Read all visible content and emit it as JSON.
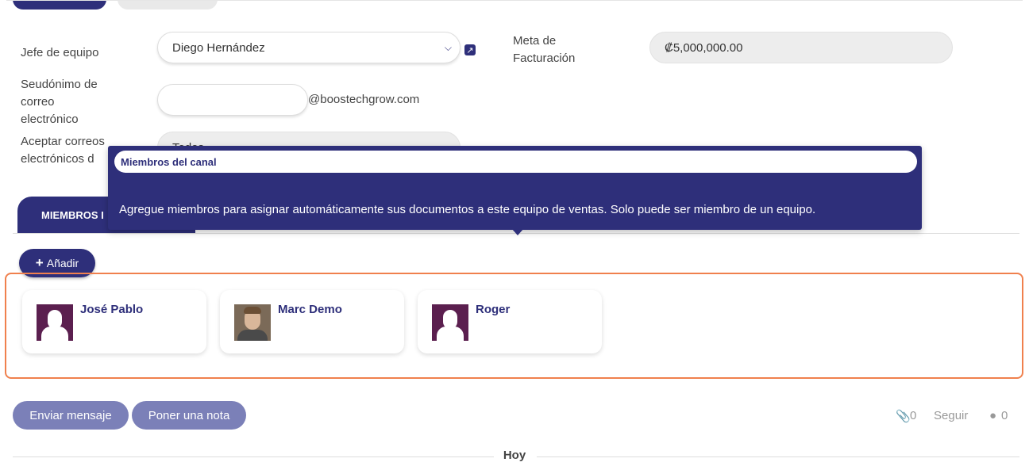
{
  "form": {
    "team_leader_label": "Jefe de equipo",
    "team_leader_value": "Diego Hernández",
    "goal_label_line1": "Meta de",
    "goal_label_line2": "Facturación",
    "goal_value": "₡5,000,000.00",
    "alias_label_line1": "Seudónimo de",
    "alias_label_line2": "correo",
    "alias_label_line3": "electrónico",
    "alias_value": "",
    "alias_domain": "@boostechgrow.com",
    "accept_label_line1": "Aceptar correos",
    "accept_label_line2": "electrónicos d",
    "accept_value": "Todos"
  },
  "tab": {
    "label": "MIEMBROS I"
  },
  "tooltip": {
    "title": "Miembros del canal",
    "body": "Agregue miembros para asignar automáticamente sus documentos a este equipo de ventas. Solo puede ser miembro de un equipo."
  },
  "add_button": {
    "label": "Añadir",
    "icon": "plus-icon"
  },
  "members": [
    {
      "name": "José Pablo",
      "avatar": "default-user-icon"
    },
    {
      "name": "Marc Demo",
      "avatar": "photo"
    },
    {
      "name": "Roger",
      "avatar": "default-user-icon"
    }
  ],
  "chatter": {
    "send_message": "Enviar mensaje",
    "log_note": "Poner una nota",
    "attachments_count": "0",
    "follow": "Seguir",
    "followers_count": "0"
  },
  "timeline": {
    "today": "Hoy"
  },
  "colors": {
    "primary": "#2e2f7a",
    "highlight": "#f0804d",
    "secondary_button": "#7b80b8"
  }
}
